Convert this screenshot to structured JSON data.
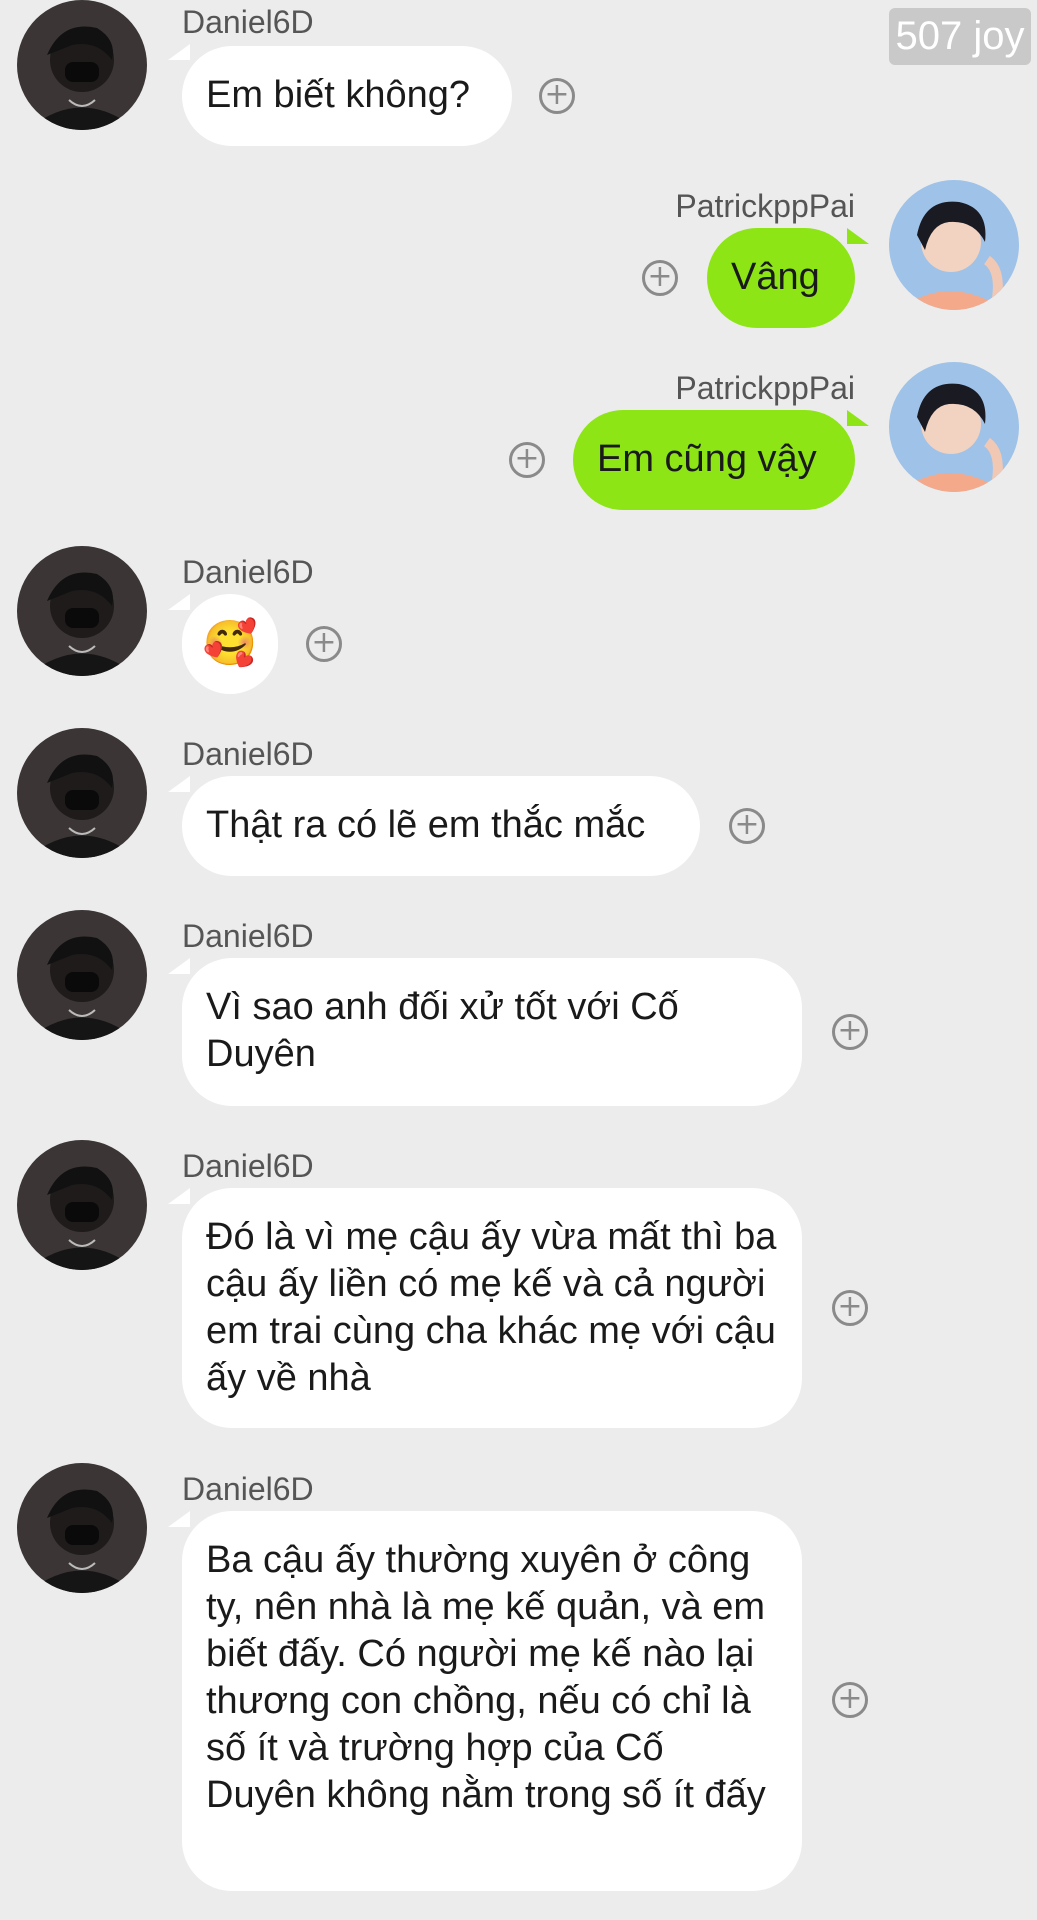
{
  "watermark": "507 joy",
  "users": {
    "left": "Daniel6D",
    "right": "PatrickppPai"
  },
  "icons": {
    "add_reaction": "plus-circle-icon",
    "emoji": "smiling-face-with-hearts"
  },
  "colors": {
    "background": "#ececec",
    "incoming_bubble": "#ffffff",
    "outgoing_bubble": "#8de516"
  },
  "messages": [
    {
      "side": "left",
      "sender": "Daniel6D",
      "text": "Em biết không?"
    },
    {
      "side": "right",
      "sender": "PatrickppPai",
      "text": "Vâng"
    },
    {
      "side": "right",
      "sender": "PatrickppPai",
      "text": "Em cũng vậy"
    },
    {
      "side": "left",
      "sender": "Daniel6D",
      "text": "🥰"
    },
    {
      "side": "left",
      "sender": "Daniel6D",
      "text": "Thật ra có lẽ em thắc mắc"
    },
    {
      "side": "left",
      "sender": "Daniel6D",
      "text": "Vì sao anh đối xử tốt với Cố Duyên"
    },
    {
      "side": "left",
      "sender": "Daniel6D",
      "text": "Đó là vì mẹ cậu ấy vừa mất thì ba cậu ấy liền có mẹ kế và cả người em trai cùng cha khác mẹ với cậu ấy về nhà"
    },
    {
      "side": "left",
      "sender": "Daniel6D",
      "text": "Ba cậu ấy thường xuyên ở công ty, nên nhà là mẹ kế quản, và em biết đấy. Có người mẹ kế nào lại thương con chồng, nếu có chỉ là số ít và trường hợp của Cố Duyên không nằm trong số ít đấy"
    }
  ]
}
